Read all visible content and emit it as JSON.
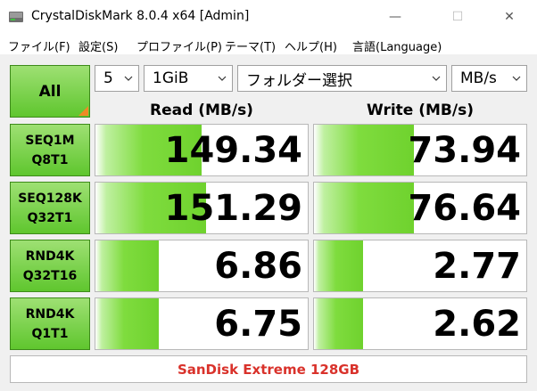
{
  "window": {
    "title": "CrystalDiskMark 8.0.4 x64 [Admin]",
    "minimize": "—",
    "maximize": "☐",
    "close": "✕"
  },
  "menu": {
    "items": [
      "ファイル(F)",
      "設定(S)",
      "プロファイル(P)",
      "テーマ(T)",
      "ヘルプ(H)",
      "言語(Language)"
    ]
  },
  "controls": {
    "all_label": "All",
    "count": "5",
    "size": "1GiB",
    "folder": "フォルダー選択",
    "unit": "MB/s"
  },
  "headers": {
    "read": "Read (MB/s)",
    "write": "Write (MB/s)"
  },
  "tests": [
    {
      "line1": "SEQ1M",
      "line2": "Q8T1",
      "read": "149.34",
      "write": "73.94",
      "read_fill": 0.5,
      "write_fill": 0.47
    },
    {
      "line1": "SEQ128K",
      "line2": "Q32T1",
      "read": "151.29",
      "write": "76.64",
      "read_fill": 0.52,
      "write_fill": 0.47
    },
    {
      "line1": "RND4K",
      "line2": "Q32T16",
      "read": "6.86",
      "write": "2.77",
      "read_fill": 0.3,
      "write_fill": 0.23
    },
    {
      "line1": "RND4K",
      "line2": "Q1T1",
      "read": "6.75",
      "write": "2.62",
      "read_fill": 0.3,
      "write_fill": 0.23
    }
  ],
  "status": {
    "comment": "SanDisk Extreme 128GB"
  },
  "colors": {
    "accent_green": "#6fd22e",
    "status_red": "#d9322b",
    "corner_orange": "#f08a24"
  }
}
